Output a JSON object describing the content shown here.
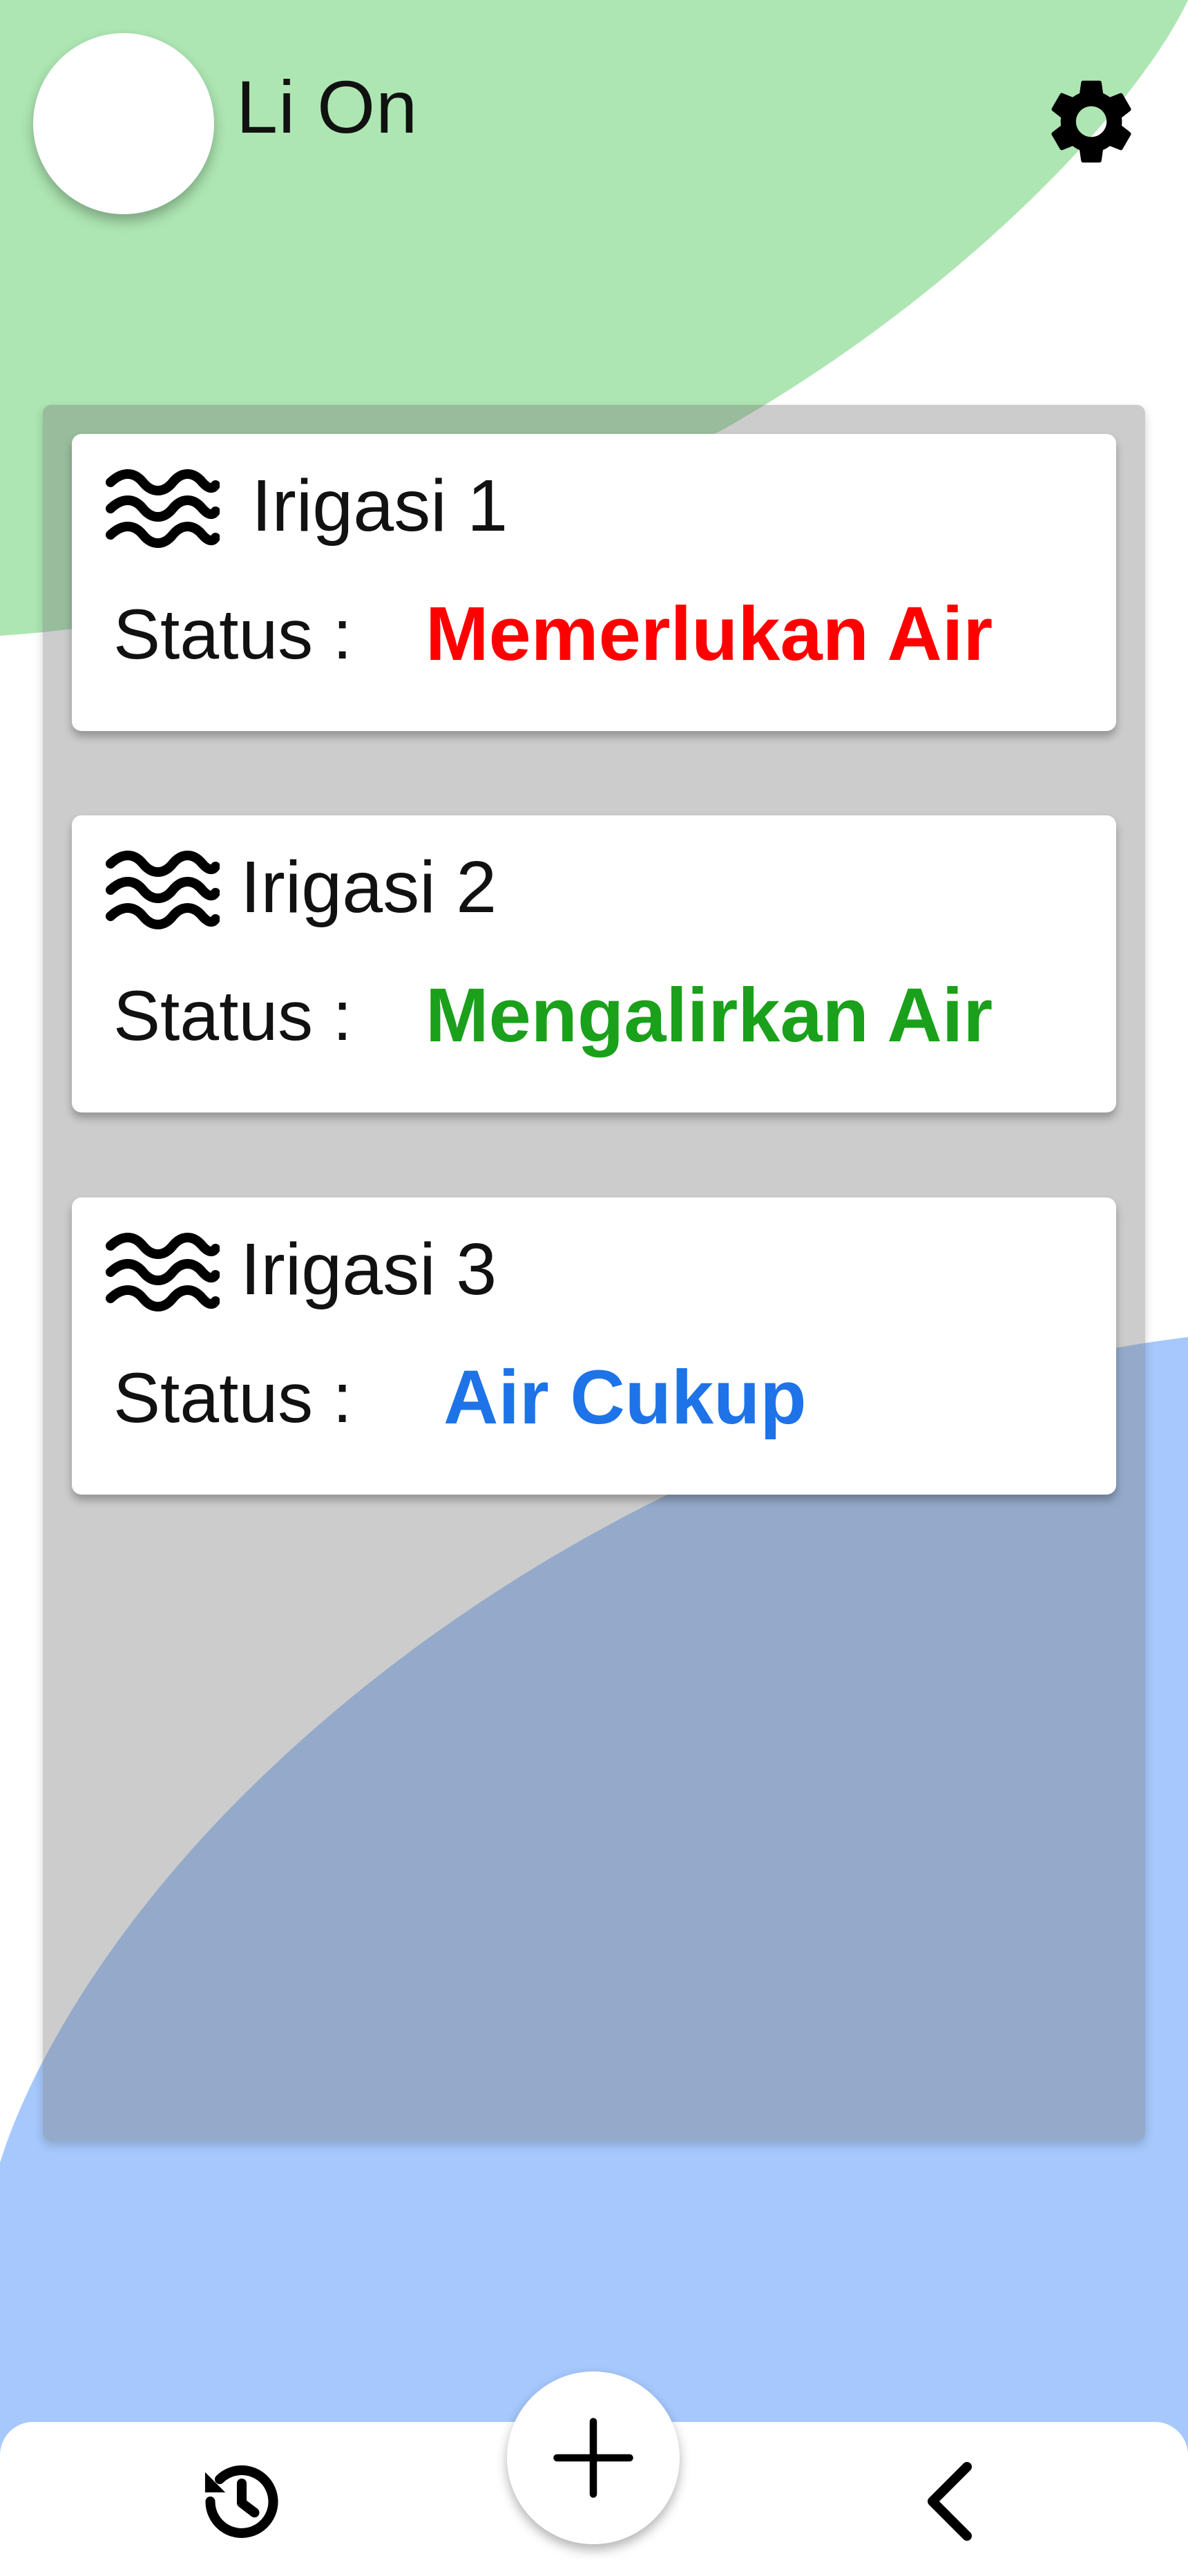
{
  "header": {
    "app_title": "Li On",
    "settings_icon": "gear-icon",
    "avatar_color": "#ffffff"
  },
  "irrigations": [
    {
      "title": "Irigasi 1",
      "status_label": "Status :",
      "status_value": "Memerlukan Air",
      "status_color": "#ff0000",
      "icon": "water-waves-icon"
    },
    {
      "title": "Irigasi 2",
      "status_label": "Status :",
      "status_value": "Mengalirkan Air",
      "status_color": "#1aa01a",
      "icon": "water-waves-icon"
    },
    {
      "title": "Irigasi 3",
      "status_label": "Status :",
      "status_value": "Air Cukup",
      "status_color": "#1e73e8",
      "icon": "water-waves-icon"
    }
  ],
  "bottom_nav": {
    "history_icon": "history-icon",
    "add_icon": "plus-icon",
    "back_icon": "chevron-left-icon"
  },
  "colors": {
    "green_blob": "#ade6b2",
    "blue_blob": "#a6c8fc",
    "panel_overlay": "#b4b4b4"
  }
}
